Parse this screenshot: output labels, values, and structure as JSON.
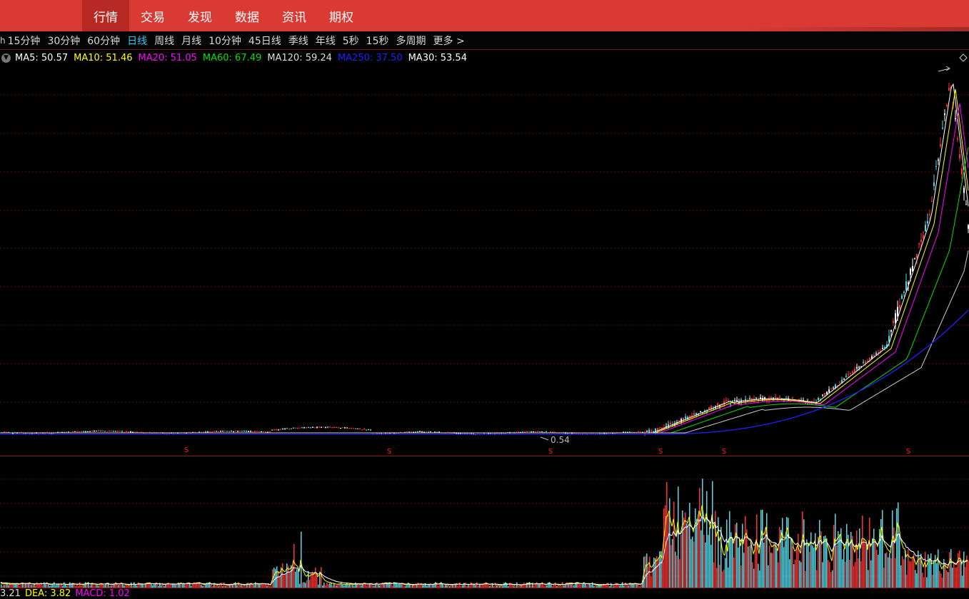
{
  "topnav": {
    "items": [
      {
        "label": "行情",
        "active": true
      },
      {
        "label": "交易"
      },
      {
        "label": "发现"
      },
      {
        "label": "数据"
      },
      {
        "label": "资讯"
      },
      {
        "label": "期权"
      }
    ]
  },
  "periodbar": {
    "lead": "h",
    "items": [
      "15分钟",
      "30分钟",
      "60分钟",
      "日线",
      "周线",
      "月线",
      "10分钟",
      "45日线",
      "季线",
      "年线",
      "5秒",
      "15秒",
      "多周期"
    ],
    "active": "日线",
    "more_label": "更多 >"
  },
  "ma_legend": {
    "toggle_icon": "chevron-down-icon",
    "items": [
      {
        "label": "MA5: 50.57",
        "color": "#ffffff"
      },
      {
        "label": "MA10: 51.46",
        "color": "#ffff00"
      },
      {
        "label": "MA20: 51.05",
        "color": "#ff00ff"
      },
      {
        "label": "MA60: 67.49",
        "color": "#00e000"
      },
      {
        "label": "MA120: 59.24",
        "color": "#dddddd"
      },
      {
        "label": "MA250: 37.50",
        "color": "#2020ff"
      },
      {
        "label": "MA30: 53.54",
        "color": "#ffffff"
      }
    ]
  },
  "chart": {
    "low_label": "0.54",
    "marker_labels": [
      "S",
      "S",
      "S",
      "S",
      "S",
      "S"
    ],
    "colors": {
      "up": "#ff3030",
      "down": "#54d8e8",
      "grid": "#5a1010",
      "separator": "#8a1a1a",
      "ma5": "#ffffff",
      "ma10": "#ffff00",
      "ma20": "#ff00ff",
      "ma60": "#00e000",
      "ma120": "#cccccc",
      "ma250": "#2020ff"
    }
  },
  "macd_bar": {
    "items": [
      {
        "label": "3.21",
        "color": "#dddddd"
      },
      {
        "label": "DEA: 3.82",
        "color": "#ffff00"
      },
      {
        "label": "MACD: 1.02",
        "color": "#ff00ff"
      }
    ]
  }
}
